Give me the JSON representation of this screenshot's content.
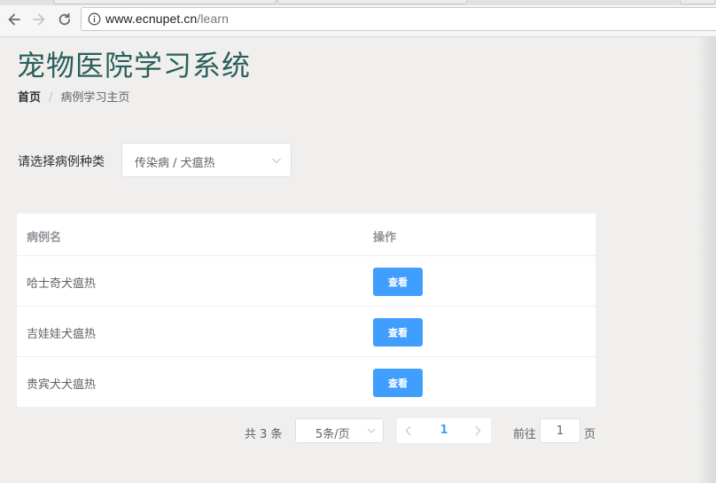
{
  "browser": {
    "url_main": "www.ecnupet.cn",
    "url_path": "/learn"
  },
  "header": {
    "title": "宠物医院学习系统"
  },
  "breadcrumb": {
    "home": "首页",
    "separator": "/",
    "current": "病例学习主页"
  },
  "filter": {
    "label": "请选择病例种类",
    "value": "传染病 / 犬瘟热"
  },
  "table": {
    "columns": [
      "病例名",
      "操作"
    ],
    "rows": [
      {
        "name": "哈士奇犬瘟热",
        "action": "查看"
      },
      {
        "name": "吉娃娃犬瘟热",
        "action": "查看"
      },
      {
        "name": "贵宾犬犬瘟热",
        "action": "查看"
      }
    ]
  },
  "pagination": {
    "total": "共 3 条",
    "page_size": "5条/页",
    "current_page": "1",
    "goto_label": "前往",
    "goto_value": "1",
    "goto_suffix": "页"
  },
  "colors": {
    "title": "#29605a",
    "primary": "#409eff"
  }
}
